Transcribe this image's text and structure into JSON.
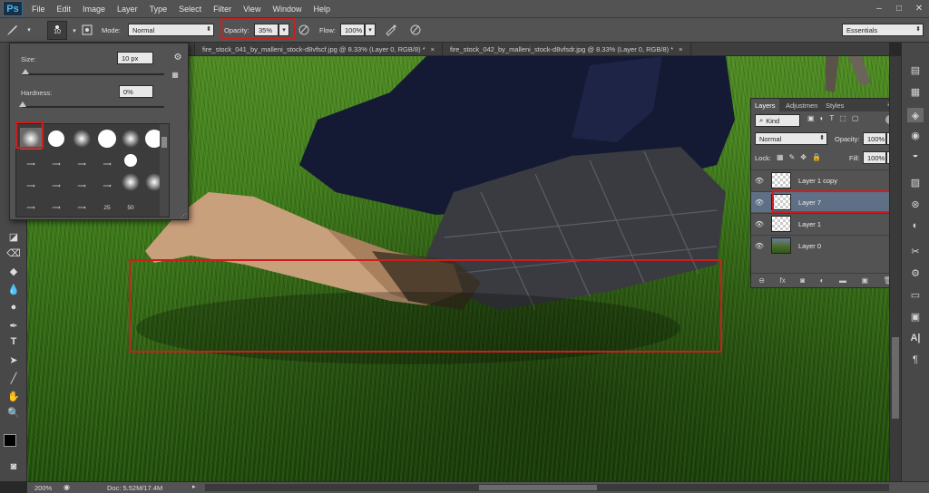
{
  "app": {
    "logo": "Ps"
  },
  "menu": [
    "File",
    "Edit",
    "Image",
    "Layer",
    "Type",
    "Select",
    "Filter",
    "View",
    "Window",
    "Help"
  ],
  "window_controls": [
    "–",
    "□",
    "✕"
  ],
  "options_bar": {
    "brush_size": "10",
    "mode_label": "Mode:",
    "mode_value": "Normal",
    "opacity_label": "Opacity:",
    "opacity_value": "35%",
    "flow_label": "Flow:",
    "flow_value": "100%",
    "workspace": "Essentials"
  },
  "tabs": [
    {
      "label": "fire_stock_041_by_malleni_stock-d8vfscf.jpg @ 8.33% (Layer 0, RGB/8) *",
      "active": false
    },
    {
      "label": "fire_stock_042_by_malleni_stock-d8vfsdr.jpg @ 8.33% (Layer 0, RGB/8) *",
      "active": false
    }
  ],
  "brush_picker": {
    "size_label": "Size:",
    "size_value": "10 px",
    "hardness_label": "Hardness:",
    "hardness_value": "0%",
    "size_level": 0.02,
    "hardness_level": 0.0,
    "brush_numbers": [
      "25",
      "50"
    ]
  },
  "layers_panel": {
    "tabs": [
      "Layers",
      "Adjustmen",
      "Styles"
    ],
    "kind_label": "Kind",
    "blend_mode": "Normal",
    "opacity_label": "Opacity:",
    "opacity_value": "100%",
    "lock_label": "Lock:",
    "fill_label": "Fill:",
    "fill_value": "100%",
    "layers": [
      {
        "name": "Layer 1 copy",
        "selected": false,
        "thumb": "transparent"
      },
      {
        "name": "Layer 7",
        "selected": true,
        "thumb": "transparent"
      },
      {
        "name": "Layer 1",
        "selected": false,
        "thumb": "transparent"
      },
      {
        "name": "Layer 0",
        "selected": false,
        "thumb": "image"
      }
    ]
  },
  "status_bar": {
    "zoom": "200%",
    "doc": "Doc: 5.52M/17.4M"
  },
  "colors": {
    "highlight_red": "#cc1e1e",
    "selected_layer": "#5f6f86",
    "panel_bg": "#535353"
  }
}
